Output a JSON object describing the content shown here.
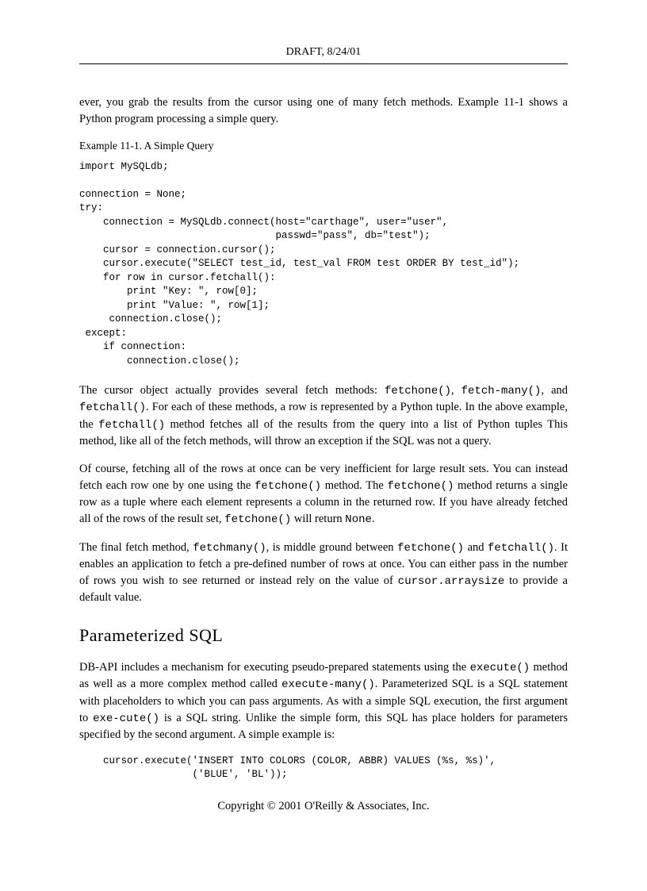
{
  "header": "DRAFT, 8/24/01",
  "para1_a": "ever, you grab the results from the cursor using one of many fetch methods. Example 11-1 shows a Python program processing a simple query.",
  "example_label": "Example 11-1. A Simple Query",
  "code1": "import MySQLdb;\n\nconnection = None;\ntry:\n    connection = MySQLdb.connect(host=\"carthage\", user=\"user\",\n                                 passwd=\"pass\", db=\"test\");\n    cursor = connection.cursor();\n    cursor.execute(\"SELECT test_id, test_val FROM test ORDER BY test_id\");\n    for row in cursor.fetchall():\n        print \"Key: \", row[0];\n        print \"Value: \", row[1];\n     connection.close();\n except:\n    if connection:\n        connection.close();",
  "para2_a": "The cursor object actually provides several fetch methods: ",
  "para2_b": "fetchone()",
  "para2_c": ", ",
  "para2_d": "fetch-many()",
  "para2_e": ", and ",
  "para2_f": "fetchall()",
  "para2_g": ". For each of these methods, a row is represented by a Python tuple. In the above example, the ",
  "para2_h": "fetchall()",
  "para2_i": " method fetches all of the results from the query into a list of Python tuples This method, like all of the fetch methods, will throw an exception if the SQL was not a query.",
  "para3_a": "Of course, fetching all of the rows at once can be very inefficient for large result sets. You can instead fetch each row one by one using the ",
  "para3_b": "fetchone()",
  "para3_c": " method. The ",
  "para3_d": "fetchone()",
  "para3_e": " method returns a single row as a tuple where each element represents a column in the returned row. If you have already fetched all of the rows of the result set, ",
  "para3_f": "fetchone()",
  "para3_g": " will return ",
  "para3_h": "None",
  "para3_i": ".",
  "para4_a": "The final fetch method, ",
  "para4_b": "fetchmany()",
  "para4_c": ", is middle ground between ",
  "para4_d": "fetchone()",
  "para4_e": " and ",
  "para4_f": "fetchall()",
  "para4_g": ". It enables an application to fetch a pre-defined number of rows at once. You can either pass in the number of rows you wish to see returned or instead rely on the value of ",
  "para4_h": "cursor.arraysize",
  "para4_i": " to provide a default value.",
  "section_title": "Parameterized SQL",
  "para5_a": "DB-API includes a mechanism for executing pseudo-prepared statements using the ",
  "para5_b": "execute()",
  "para5_c": " method as well as a more complex method called ",
  "para5_d": "execute-many()",
  "para5_e": ". Parameterized SQL is a SQL statement with placeholders to which you can pass arguments. As with a simple SQL execution, the first argument to ",
  "para5_f": "exe-cute()",
  "para5_g": " is a SQL string. Unlike the simple form, this SQL has place holders for parameters specified by the second argument. A simple example is:",
  "code2": "cursor.execute('INSERT INTO COLORS (COLOR, ABBR) VALUES (%s, %s)',\n               ('BLUE', 'BL'));",
  "footer": "Copyright © 2001 O'Reilly & Associates, Inc."
}
